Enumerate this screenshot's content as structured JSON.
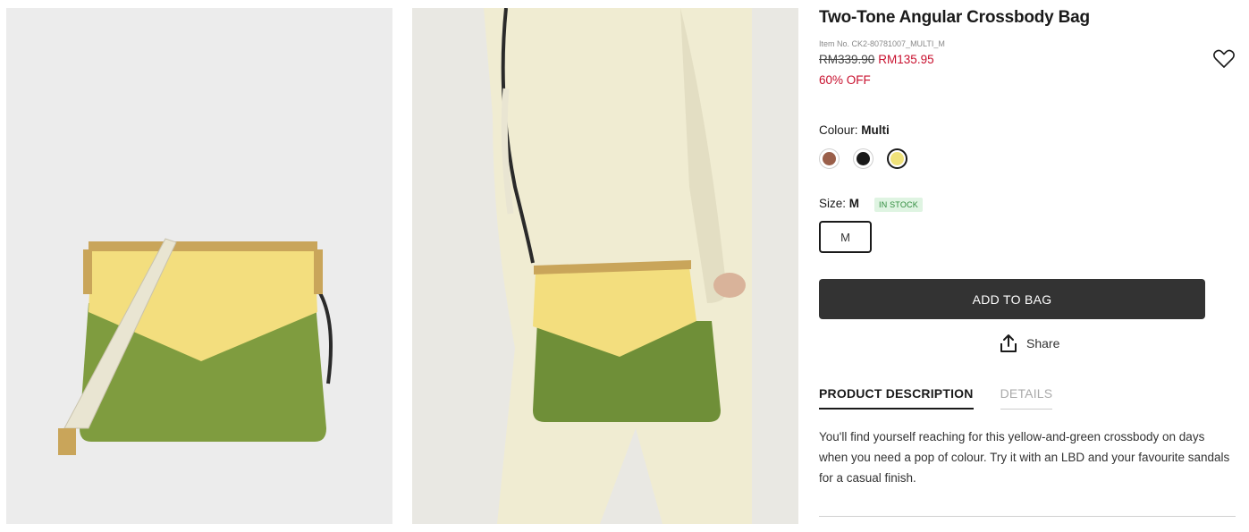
{
  "product": {
    "title": "Two-Tone Angular Crossbody Bag",
    "item_no": "Item No. CK2-80781007_MULTI_M",
    "price_original": "RM339.90",
    "price_sale": "RM135.95",
    "discount": "60% OFF"
  },
  "colour": {
    "label": "Colour:",
    "selected": "Multi",
    "swatches": [
      {
        "color": "#9a5f4a",
        "selected": false
      },
      {
        "color": "#1a1a1a",
        "selected": false
      },
      {
        "color": "#f0e27a",
        "selected": true
      }
    ]
  },
  "size": {
    "label": "Size:",
    "selected": "M",
    "stock_badge": "IN STOCK",
    "options": [
      "M"
    ]
  },
  "actions": {
    "add_to_bag": "ADD TO BAG",
    "share": "Share"
  },
  "tabs": {
    "items": [
      "PRODUCT DESCRIPTION",
      "DETAILS"
    ],
    "active": "PRODUCT DESCRIPTION"
  },
  "description": "You'll find yourself reaching for this yellow-and-green crossbody on days when you need a pop of colour. Try it with an LBD and your favourite sandals for a casual finish.",
  "icons": {
    "wishlist": "heart-icon",
    "share": "share-upload-icon"
  },
  "colors": {
    "accent_red": "#c8102e",
    "button_dark": "#333333",
    "stock_green": "#2e8b3c"
  }
}
